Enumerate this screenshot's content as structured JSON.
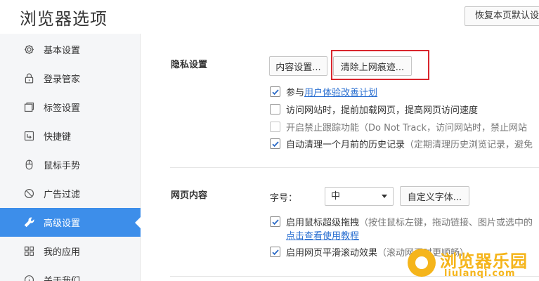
{
  "header": {
    "title": "浏览器选项",
    "restore_button": "恢复本页默认设置"
  },
  "sidebar": {
    "items": [
      {
        "label": "基本设置",
        "icon": "gear-icon"
      },
      {
        "label": "登录管家",
        "icon": "lock-icon"
      },
      {
        "label": "标签设置",
        "icon": "tabs-icon"
      },
      {
        "label": "快捷键",
        "icon": "keyboard-icon"
      },
      {
        "label": "鼠标手势",
        "icon": "mouse-icon"
      },
      {
        "label": "广告过滤",
        "icon": "block-icon"
      },
      {
        "label": "高级设置",
        "icon": "wrench-icon",
        "active": true
      },
      {
        "label": "我的应用",
        "icon": "apps-icon"
      },
      {
        "label": "关于我们",
        "icon": "info-icon"
      }
    ]
  },
  "privacy": {
    "title": "隐私设置",
    "content_settings_button": "内容设置...",
    "clear_traces_button": "清除上网痕迹...",
    "options": [
      {
        "prefix": "参与 ",
        "link": "用户体验改善计划",
        "checked": true
      },
      {
        "text": "访问网站时，提前加载网页，提高网页访问速度",
        "checked": false
      },
      {
        "text": "开启禁止跟踪功能（Do Not Track，访问网站时，禁止网站",
        "checked": false,
        "disabled": true
      },
      {
        "text": "自动清理一个月前的历史记录",
        "note": "（定期清理历史浏览记录，避免",
        "checked": true
      }
    ]
  },
  "webcontent": {
    "title": "网页内容",
    "font_size_label": "字号：",
    "font_size_value": "中",
    "custom_font_button": "自定义字体...",
    "drag_option": {
      "text": "启用鼠标超级拖拽",
      "note": "（按住鼠标左键，拖动链接、图片或选中的",
      "link": "点击查看使用教程",
      "checked": true
    },
    "smooth_option": {
      "text": "启用网页平滑滚动效果",
      "note": "（滚动网页时更顺畅）",
      "checked": true
    }
  },
  "watermark": {
    "text": "浏览器乐园",
    "sub": "liulanqi.com"
  },
  "colors": {
    "accent": "#3d8eea",
    "highlight": "#d9262d",
    "link": "#2a6fd1",
    "watermark": "#f5b51b"
  }
}
